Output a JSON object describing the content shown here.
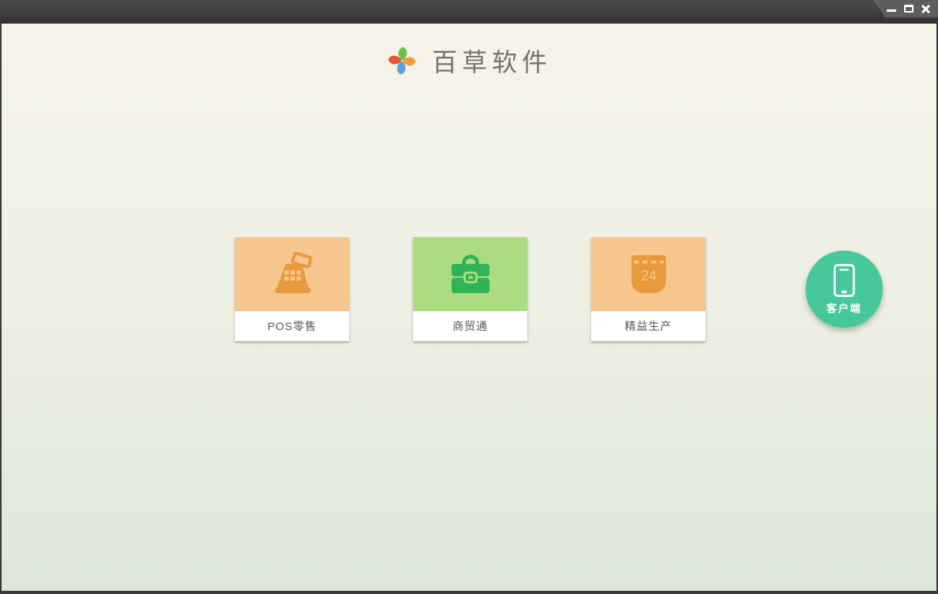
{
  "window": {
    "controls": {
      "minimize": "minimize",
      "maximize": "maximize",
      "close": "close"
    }
  },
  "header": {
    "app_name": "百草软件",
    "logo_icon": "pinwheel-icon"
  },
  "cards": [
    {
      "label": "POS零售",
      "icon": "cash-register-icon",
      "bg_color": "#f5c78e",
      "icon_color": "#e89a3c"
    },
    {
      "label": "商贸通",
      "icon": "briefcase-icon",
      "bg_color": "#abdc81",
      "icon_color": "#2eb356"
    },
    {
      "label": "精益生产",
      "icon": "calendar-icon",
      "calendar_day": "24",
      "bg_color": "#f5c78e",
      "icon_color": "#e89a3c"
    }
  ],
  "client_button": {
    "label": "客户端",
    "icon": "smartphone-icon",
    "bg_color": "#46c89b"
  },
  "colors": {
    "titlebar_top": "#4c4c4a",
    "titlebar_bottom": "#313130",
    "frame": "#3a3a38",
    "content_top": "#f7f4ea",
    "content_bottom": "#dde7d9",
    "card_label_text": "#54575a",
    "logo_text": "#75756d",
    "pinwheel_green": "#6cc24a",
    "pinwheel_orange": "#f49d3f",
    "pinwheel_blue": "#5f9fd8",
    "pinwheel_red": "#e45531"
  }
}
